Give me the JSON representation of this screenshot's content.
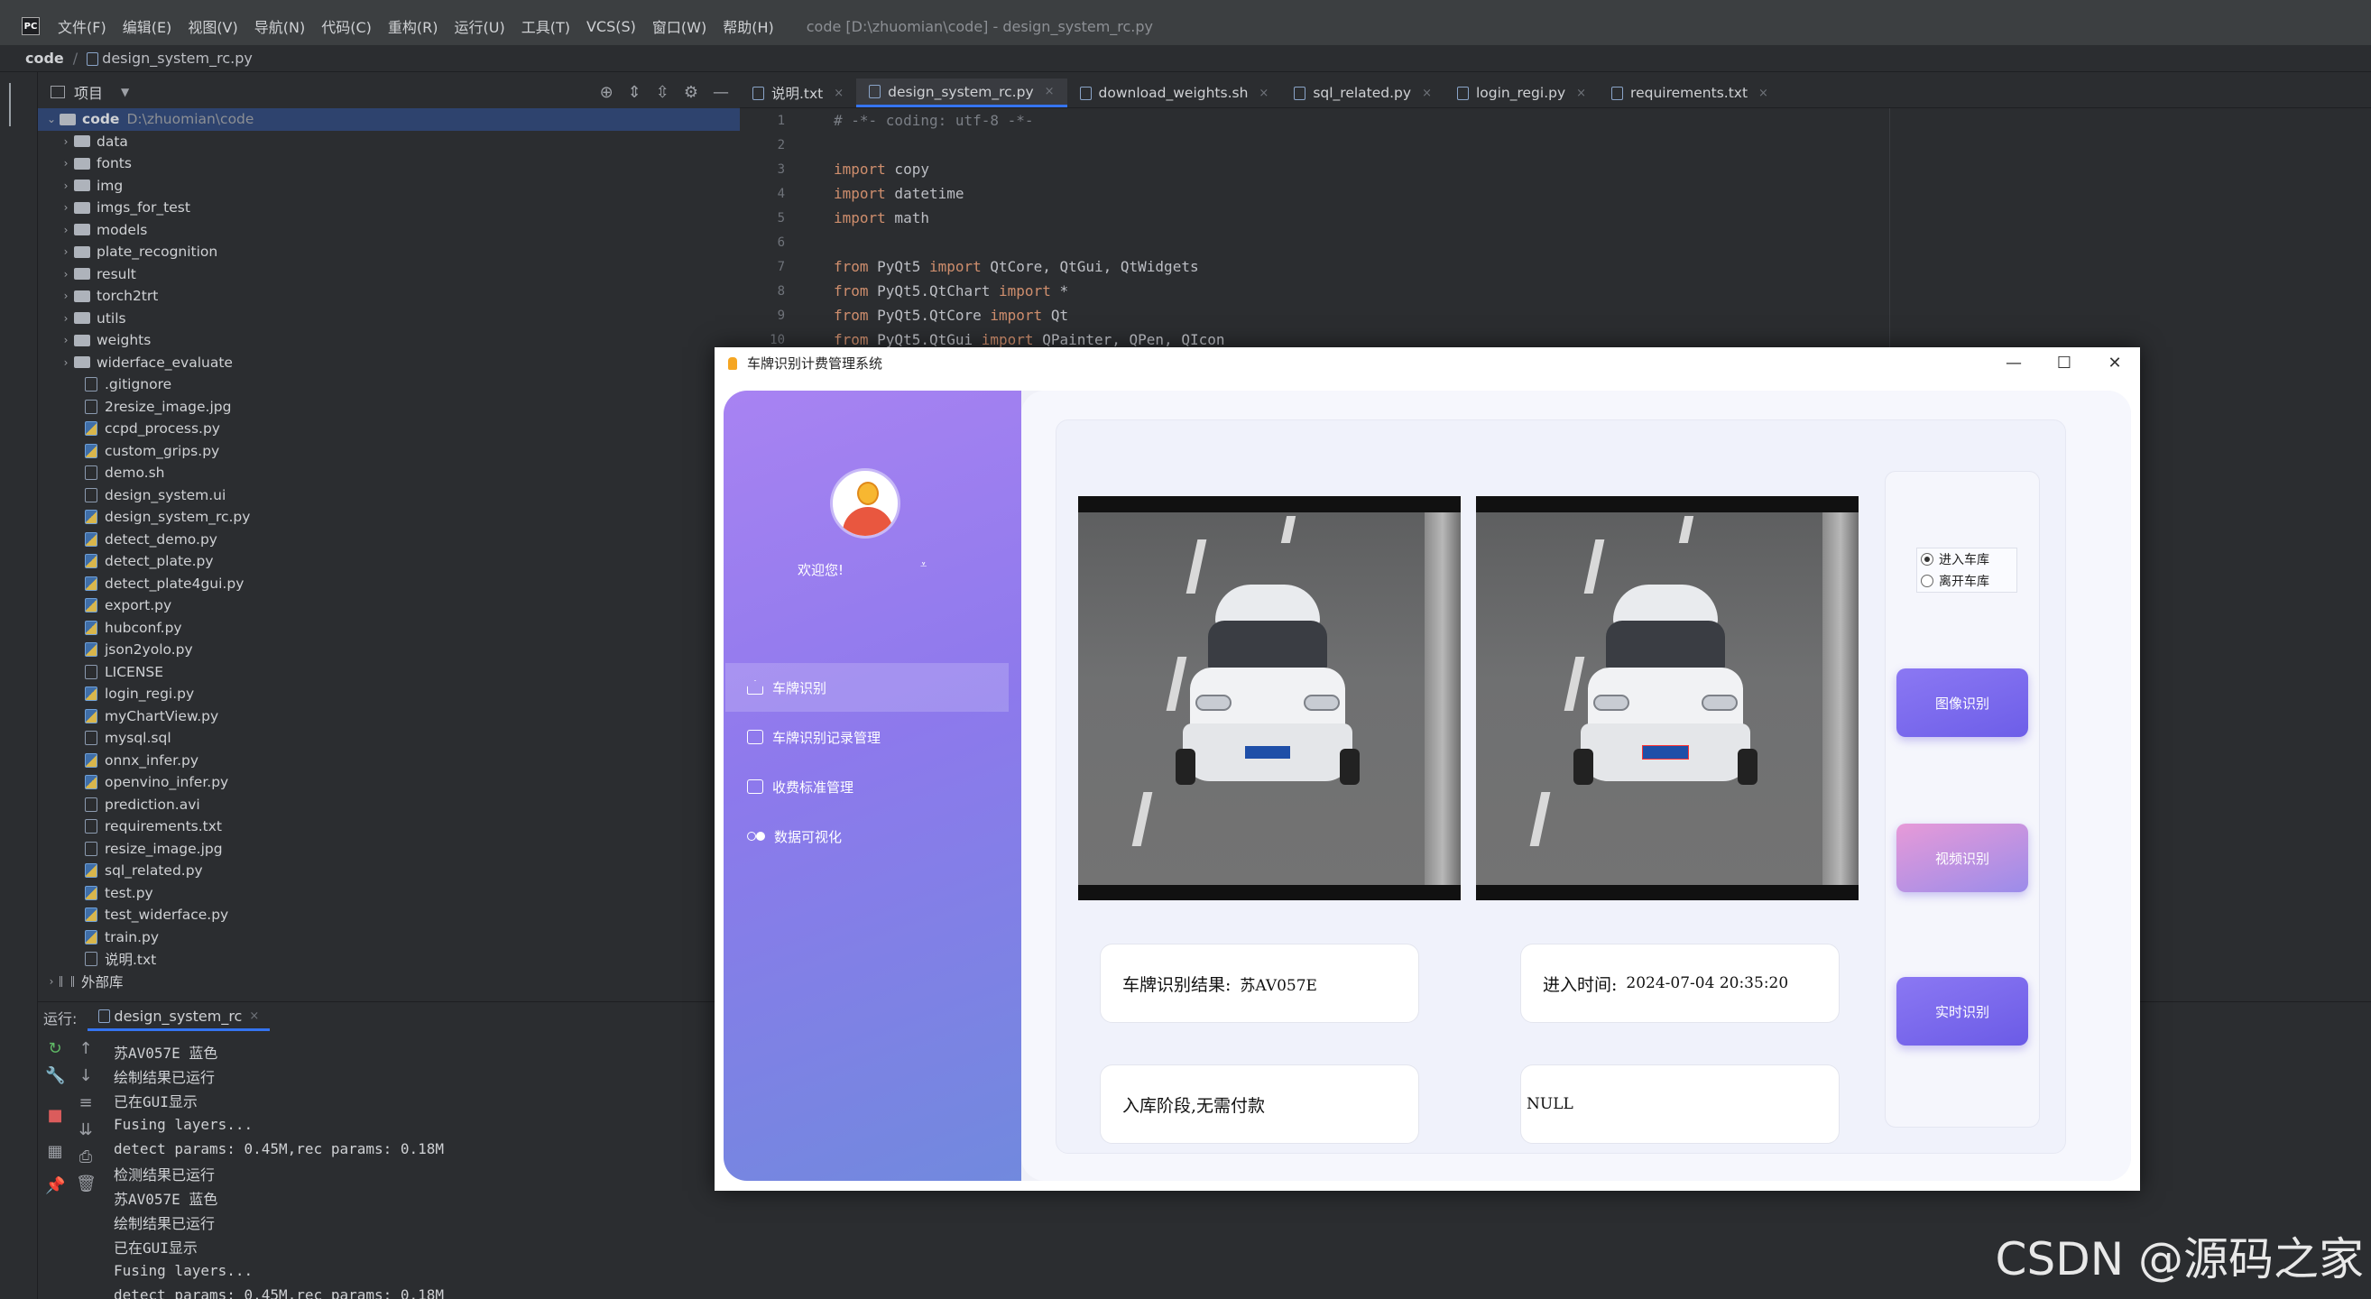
{
  "ide": {
    "menu": [
      "文件(F)",
      "编辑(E)",
      "视图(V)",
      "导航(N)",
      "代码(C)",
      "重构(R)",
      "运行(U)",
      "工具(T)",
      "VCS(S)",
      "窗口(W)",
      "帮助(H)"
    ],
    "title": "code [D:\\zhuomian\\code] - design_system_rc.py",
    "breadcrumb_root": "code",
    "breadcrumb_file": "design_system_rc.py",
    "strip_label": "项目",
    "project_header": "项目",
    "tree_root": "code",
    "tree_root_path": "D:\\zhuomian\\code",
    "folders": [
      "data",
      "fonts",
      "img",
      "imgs_for_test",
      "models",
      "plate_recognition",
      "result",
      "torch2trt",
      "utils",
      "weights",
      "widerface_evaluate"
    ],
    "files": [
      ".gitignore",
      "2resize_image.jpg",
      "ccpd_process.py",
      "custom_grips.py",
      "demo.sh",
      "design_system.ui",
      "design_system_rc.py",
      "detect_demo.py",
      "detect_plate.py",
      "detect_plate4gui.py",
      "export.py",
      "hubconf.py",
      "json2yolo.py",
      "LICENSE",
      "login_regi.py",
      "myChartView.py",
      "mysql.sql",
      "onnx_infer.py",
      "openvino_infer.py",
      "prediction.avi",
      "requirements.txt",
      "resize_image.jpg",
      "sql_related.py",
      "test.py",
      "test_widerface.py",
      "train.py",
      "说明.txt"
    ],
    "external_libs": "外部库",
    "tabs": [
      "说明.txt",
      "design_system_rc.py",
      "download_weights.sh",
      "sql_related.py",
      "login_regi.py",
      "requirements.txt"
    ],
    "active_tab": 1,
    "code_lines": [
      {
        "n": "1",
        "kind": "comment",
        "text": "# -*- coding: utf-8 -*-"
      },
      {
        "n": "2",
        "kind": "blank",
        "text": ""
      },
      {
        "n": "3",
        "kind": "import",
        "kw": "import",
        "rest": " copy"
      },
      {
        "n": "4",
        "kind": "import",
        "kw": "import",
        "rest": " datetime"
      },
      {
        "n": "5",
        "kind": "import",
        "kw": "import",
        "rest": " math"
      },
      {
        "n": "6",
        "kind": "blank",
        "text": ""
      },
      {
        "n": "7",
        "kind": "from",
        "mod": " PyQt5 ",
        "rest": " QtCore, QtGui, QtWidgets"
      },
      {
        "n": "8",
        "kind": "from",
        "mod": " PyQt5.QtChart ",
        "rest": " *"
      },
      {
        "n": "9",
        "kind": "from",
        "mod": " PyQt5.QtCore ",
        "rest": " Qt"
      },
      {
        "n": "10",
        "kind": "from",
        "mod": " PyQt5.QtGui ",
        "rest": " QPainter, QPen, QIcon"
      }
    ],
    "run_label": "运行:",
    "run_tab": "design_system_rc",
    "console": [
      "苏AV057E 蓝色",
      "绘制结果已运行",
      "已在GUI显示",
      "Fusing layers...",
      "detect params: 0.45M,rec params: 0.18M",
      "检测结果已运行",
      "苏AV057E 蓝色",
      "绘制结果已运行",
      "已在GUI显示",
      "Fusing layers...",
      "detect params: 0.45M,rec params: 0.18M"
    ]
  },
  "watermark": "CSDN @源码之家",
  "app": {
    "title": "车牌识别计费管理系统",
    "welcome": "欢迎您!",
    "nav": [
      "车牌识别",
      "车牌识别记录管理",
      "收费标准管理",
      "数据可视化"
    ],
    "radio_enter": "进入车库",
    "radio_leave": "离开车库",
    "btn_image": "图像识别",
    "btn_video": "视频识别",
    "btn_live": "实时识别",
    "plate_label": "车牌识别结果:",
    "plate_value": "苏AV057E",
    "time_label": "进入时间:",
    "time_value": "2024-07-04 20:35:20",
    "status_text": "入库阶段,无需付款",
    "fee_value": "NULL"
  }
}
